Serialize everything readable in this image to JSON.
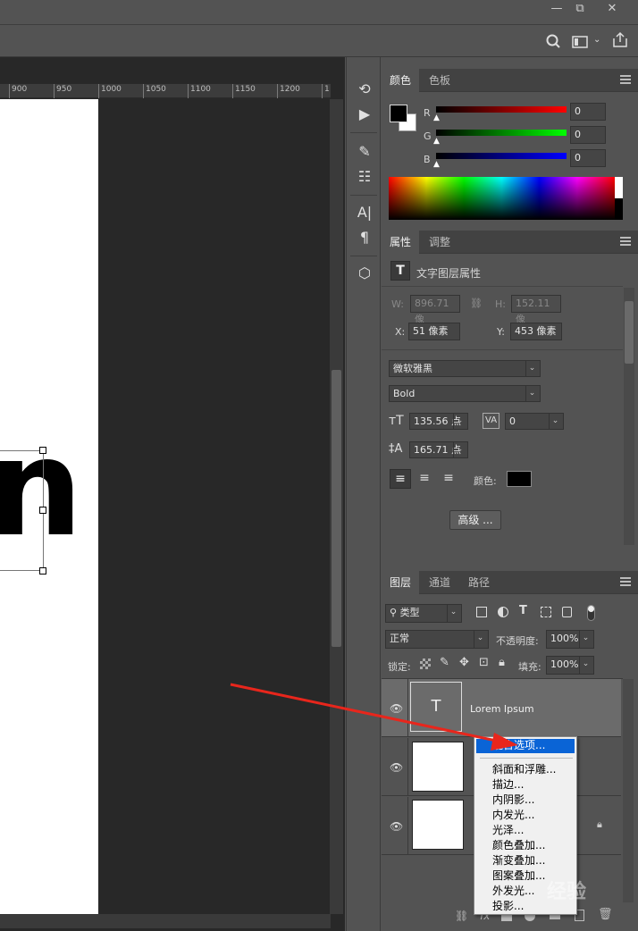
{
  "window": {
    "minimize_label": "—",
    "restore_label": "⧉",
    "close_label": "✕"
  },
  "ruler": {
    "ticks": [
      "900",
      "950",
      "1000",
      "1050",
      "1100",
      "1150",
      "1200",
      "1"
    ]
  },
  "canvas": {
    "text_fragment": "n"
  },
  "color_panel": {
    "tabs": [
      "颜色",
      "色板"
    ],
    "channels": [
      {
        "label": "R",
        "value": "0"
      },
      {
        "label": "G",
        "value": "0"
      },
      {
        "label": "B",
        "value": "0"
      }
    ]
  },
  "properties_panel": {
    "tabs": [
      "属性",
      "调整"
    ],
    "header": "文字图层属性",
    "w_label": "W:",
    "w_value": "896.71 像",
    "h_label": "H:",
    "h_value": "152.11 像",
    "x_label": "X:",
    "x_value": "51 像素",
    "y_label": "Y:",
    "y_value": "453 像素",
    "font_family": "微软雅黑",
    "font_style": "Bold",
    "font_size": "135.56 点",
    "tracking": "0",
    "leading": "165.71 点",
    "color_label": "颜色:",
    "advanced_button": "高级 ...",
    "text_color": "#000000"
  },
  "layers_panel": {
    "tabs": [
      "图层",
      "通道",
      "路径"
    ],
    "filter_label": "类型",
    "blend_mode": "正常",
    "opacity_label": "不透明度:",
    "opacity_value": "100%",
    "lock_label": "锁定:",
    "fill_label": "填充:",
    "fill_value": "100%",
    "layers": [
      {
        "name": "Lorem Ipsum",
        "type_glyph": "T"
      },
      {
        "name": "",
        "type_glyph": ""
      },
      {
        "name": "",
        "type_glyph": ""
      }
    ]
  },
  "context_menu": {
    "items": [
      "混合选项...",
      "斜面和浮雕...",
      "描边...",
      "内阴影...",
      "内发光...",
      "光泽...",
      "颜色叠加...",
      "渐变叠加...",
      "图案叠加...",
      "外发光...",
      "投影..."
    ]
  },
  "watermark": {
    "text": "经验"
  },
  "colors": {
    "arrow": "#e8261c",
    "highlight": "#0a64d6"
  }
}
